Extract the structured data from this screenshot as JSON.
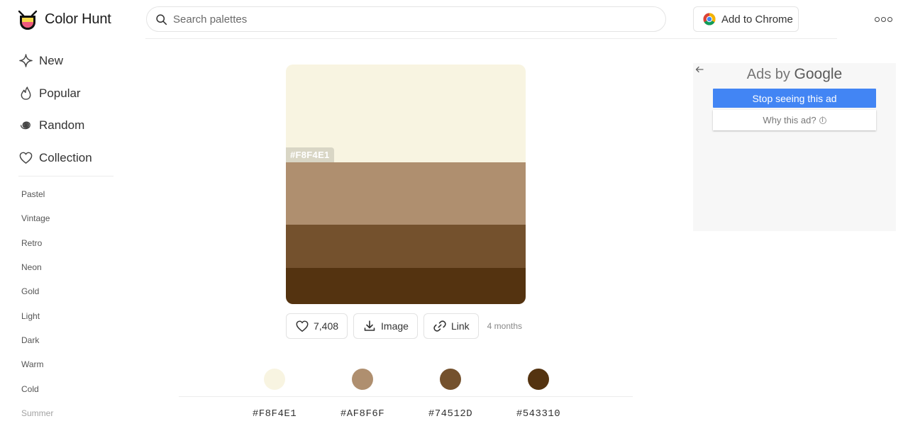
{
  "header": {
    "brand": "Color Hunt",
    "search_placeholder": "Search palettes",
    "chrome_label": "Add to Chrome"
  },
  "sidebar": {
    "nav": [
      {
        "label": "New",
        "icon": "sparkle-icon"
      },
      {
        "label": "Popular",
        "icon": "flame-icon"
      },
      {
        "label": "Random",
        "icon": "spiral-icon"
      },
      {
        "label": "Collection",
        "icon": "heart-icon"
      }
    ],
    "tags": [
      "Pastel",
      "Vintage",
      "Retro",
      "Neon",
      "Gold",
      "Light",
      "Dark",
      "Warm",
      "Cold",
      "Summer"
    ]
  },
  "palette": {
    "colors": [
      "#F8F4E1",
      "#AF8F6F",
      "#74512D",
      "#543310"
    ],
    "hover_hex": "#F8F4E1",
    "likes": "7,408",
    "image_label": "Image",
    "link_label": "Link",
    "age": "4 months"
  },
  "ad": {
    "title_prefix": "Ads by",
    "title_brand": "Google",
    "stop_label": "Stop seeing this ad",
    "why_label": "Why this ad?"
  },
  "colors": {
    "ad_button": "#4285f4"
  }
}
